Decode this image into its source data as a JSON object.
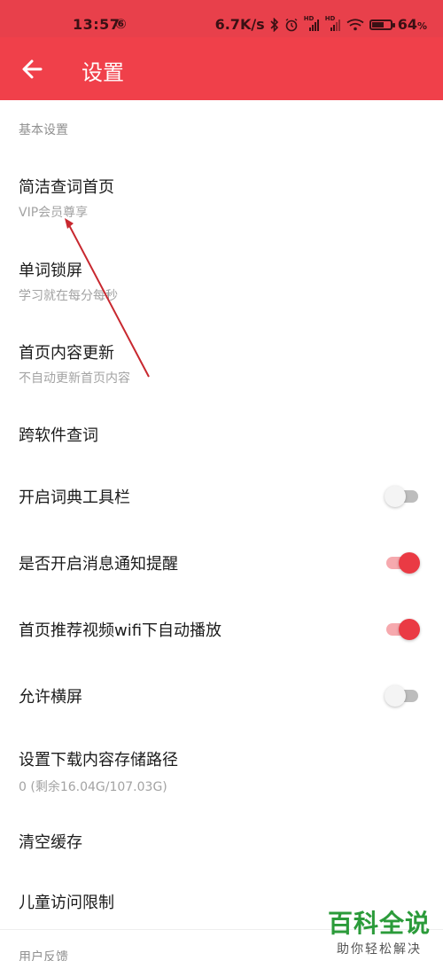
{
  "status_bar": {
    "time": "13:57",
    "netease_glyph": "⑥",
    "speed": "6.7K/s",
    "bluetooth_icon": "bluetooth-icon",
    "alarm_icon": "alarm-icon",
    "hd_signal_1": "HD",
    "hd_signal_2": "HD",
    "wifi_icon": "wifi-icon",
    "battery_level": 64,
    "battery_text": "64",
    "battery_unit": "%"
  },
  "toolbar": {
    "back_icon": "arrow-left-icon",
    "title": "设置"
  },
  "sections": {
    "basic": "基本设置",
    "feedback": "用户反馈"
  },
  "items": [
    {
      "title": "简洁查词首页",
      "subtitle": "VIP会员尊享"
    },
    {
      "title": "单词锁屏",
      "subtitle": "学习就在每分每秒"
    },
    {
      "title": "首页内容更新",
      "subtitle": "不自动更新首页内容"
    },
    {
      "title": "跨软件查词"
    },
    {
      "title": "开启词典工具栏",
      "toggle": false
    },
    {
      "title": "是否开启消息通知提醒",
      "toggle": true
    },
    {
      "title": "首页推荐视频wifi下自动播放",
      "toggle": true
    },
    {
      "title": "允许横屏",
      "toggle": false
    },
    {
      "title": "设置下载内容存储路径",
      "subtitle": "0 (剩余16.04G/107.03G)"
    },
    {
      "title": "清空缓存"
    },
    {
      "title": "儿童访问限制"
    }
  ],
  "colors": {
    "accent": "#f0404a",
    "toggle_on": "#ea3a44",
    "annotation_arrow": "#c8282f"
  },
  "watermark": {
    "title": "百科全说",
    "subtitle": "助你轻松解决"
  }
}
